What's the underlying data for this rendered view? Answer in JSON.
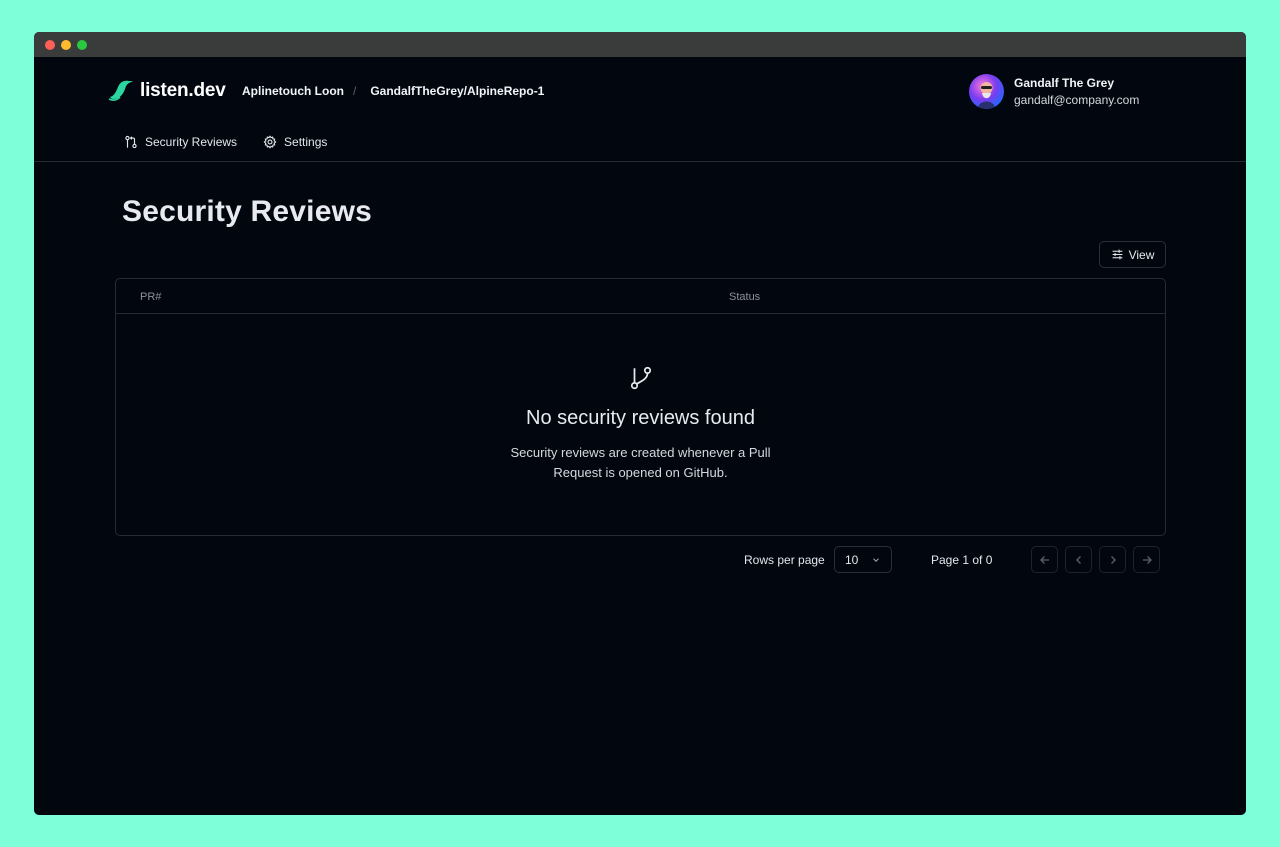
{
  "app": {
    "logo_text": "listen.dev"
  },
  "breadcrumb": {
    "org": "Aplinetouch Loon",
    "separator": "/",
    "repo": "GandalfTheGrey/AlpineRepo-1"
  },
  "user": {
    "name": "Gandalf The Grey",
    "email": "gandalf@company.com"
  },
  "nav": {
    "items": [
      {
        "label": "Security Reviews",
        "icon": "git-pull-request-icon"
      },
      {
        "label": "Settings",
        "icon": "gear-icon"
      }
    ]
  },
  "page": {
    "title": "Security Reviews"
  },
  "toolbar": {
    "view_label": "View",
    "view_icon": "sliders-icon"
  },
  "table": {
    "columns": [
      "PR#",
      "Status"
    ],
    "empty": {
      "icon": "git-branch-icon",
      "title": "No security reviews found",
      "description": "Security reviews are created whenever a Pull Request is opened on GitHub."
    }
  },
  "pagination": {
    "rows_label": "Rows per page",
    "rows_value": "10",
    "page_info": "Page 1 of 0"
  },
  "colors": {
    "background": "#7fffd9",
    "window": "#02060f",
    "brand": "#2bd6a0"
  }
}
